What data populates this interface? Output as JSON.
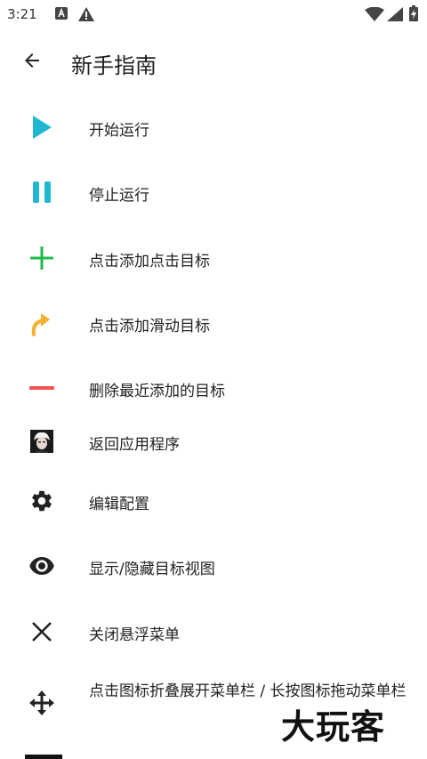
{
  "status_bar": {
    "time": "3:21"
  },
  "app_bar": {
    "title": "新手指南"
  },
  "items": [
    {
      "label": "开始运行",
      "icon": "play-icon"
    },
    {
      "label": "停止运行",
      "icon": "pause-icon"
    },
    {
      "label": "点击添加点击目标",
      "icon": "plus-icon"
    },
    {
      "label": "点击添加滑动目标",
      "icon": "swipe-arrow-icon"
    },
    {
      "label": "删除最近添加的目标",
      "icon": "minus-icon"
    },
    {
      "label": "返回应用程序",
      "icon": "app-avatar-icon"
    },
    {
      "label": "编辑配置",
      "icon": "gear-icon"
    },
    {
      "label": "显示/隐藏目标视图",
      "icon": "eye-icon"
    },
    {
      "label": "关闭悬浮菜单",
      "icon": "close-icon"
    },
    {
      "label": "点击图标折叠展开菜单栏 / 长按图标拖动菜单栏",
      "icon": "move-icon"
    }
  ],
  "watermark": "大玩客",
  "colors": {
    "play": "#1fb8d0",
    "pause": "#1fb8d0",
    "plus": "#1fb84a",
    "swipe": "#f5b02e",
    "minus": "#ef5350",
    "dark_icon": "#222222"
  }
}
